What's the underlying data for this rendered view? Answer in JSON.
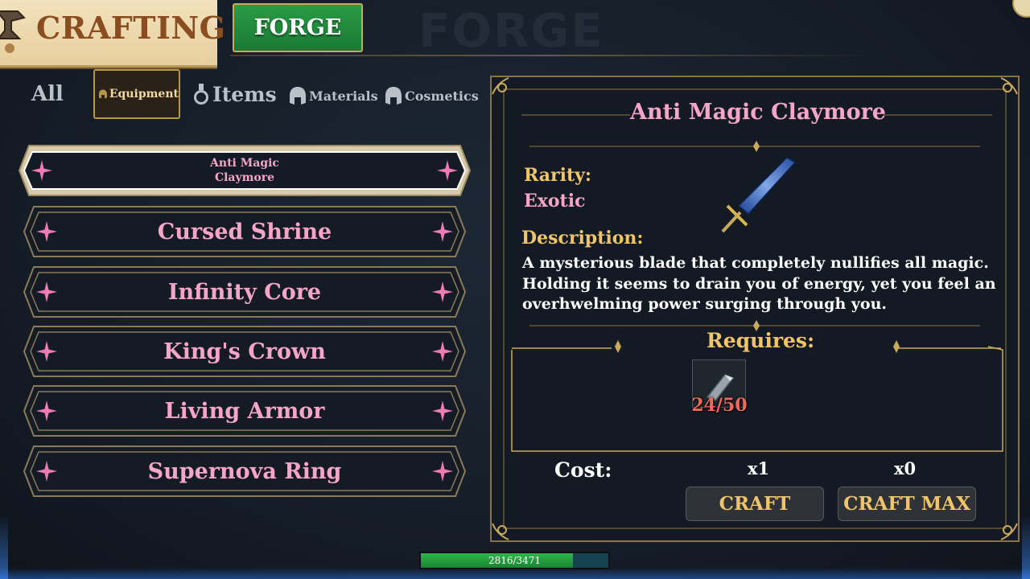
{
  "header": {
    "title": "CRAFTING",
    "active_tab": "FORGE",
    "watermark": "FORGE"
  },
  "categories": {
    "all": "All",
    "equipment": "Equipment",
    "items": "Items",
    "materials": "Materials",
    "cosmetics": "Cosmetics",
    "selected": "Equipment"
  },
  "recipes": [
    {
      "name": "Anti Magic Claymore",
      "selected": true
    },
    {
      "name": "Cursed Shrine",
      "selected": false
    },
    {
      "name": "Infinity Core",
      "selected": false
    },
    {
      "name": "King's Crown",
      "selected": false
    },
    {
      "name": "Living Armor",
      "selected": false
    },
    {
      "name": "Supernova Ring",
      "selected": false
    }
  ],
  "detail": {
    "title": "Anti Magic Claymore",
    "rarity_label": "Rarity:",
    "rarity": "Exotic",
    "description_label": "Description:",
    "description": "A mysterious blade that completely nullifies all magic. Holding it seems to drain you of energy, yet you feel an overhwelming power surging through you.",
    "item_icon": "claymore-sword-icon",
    "requires_label": "Requires:",
    "requirements": [
      {
        "icon": "metal-shard-icon",
        "count": "24/50"
      }
    ],
    "cost_label": "Cost:",
    "craft_qty": "x1",
    "craft_max_qty": "x0",
    "craft_button": "CRAFT",
    "craft_max_button": "CRAFT MAX"
  },
  "xp": {
    "text": "2816/3471",
    "current": 2816,
    "max": 3471
  },
  "colors": {
    "accent_pink": "#f5a5c8",
    "gold": "#f0c56a",
    "forge_green": "#2b9b46",
    "requirement_red": "#f06a5a"
  }
}
